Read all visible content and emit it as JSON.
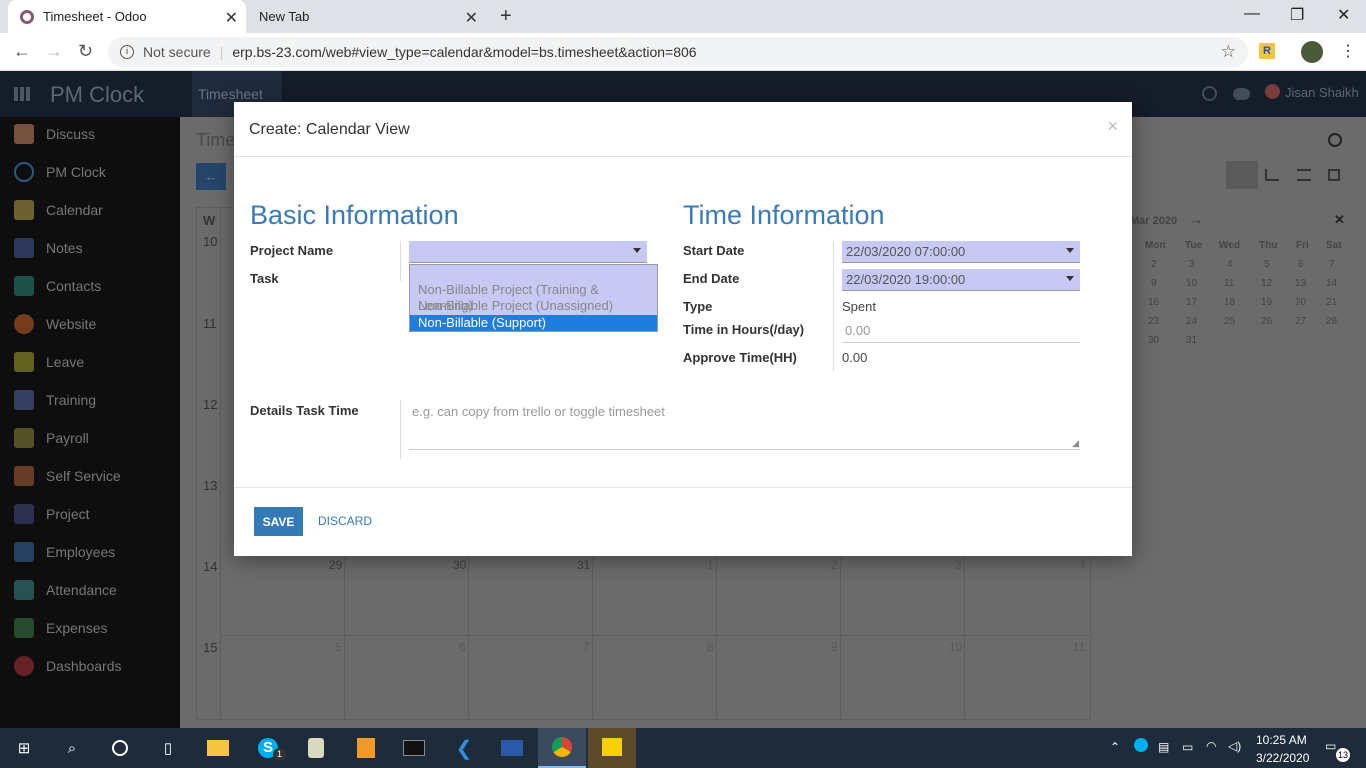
{
  "browser": {
    "tabs": [
      {
        "label": "Timesheet - Odoo",
        "active": true
      },
      {
        "label": "New Tab",
        "active": false
      }
    ],
    "security_label": "Not secure",
    "url": "erp.bs-23.com/web#view_type=calendar&model=bs.timesheet&action=806"
  },
  "app": {
    "name": "PM Clock",
    "top_menu": "Timesheet",
    "user": "Jisan Shaikh",
    "sidebar": [
      "Discuss",
      "PM Clock",
      "Calendar",
      "Notes",
      "Contacts",
      "Website",
      "Leave",
      "Training",
      "Payroll",
      "Self Service",
      "Project",
      "Employees",
      "Attendance",
      "Expenses",
      "Dashboards"
    ],
    "breadcrumb": "Time",
    "calendar": {
      "week_header": "W",
      "week_numbers": [
        "10",
        "11",
        "12",
        "13",
        "14",
        "15"
      ],
      "row14_days": [
        "29",
        "30",
        "31",
        "1",
        "2",
        "3",
        "4"
      ],
      "row15_days": [
        "5",
        "6",
        "7",
        "8",
        "9",
        "10",
        "11"
      ],
      "mini_month": "Mar 2020",
      "mini_weekdays": [
        "Mon",
        "Tue",
        "Wed",
        "Thu",
        "Fri",
        "Sat"
      ],
      "mini_rows": [
        [
          "2",
          "3",
          "4",
          "5",
          "6",
          "7"
        ],
        [
          "9",
          "10",
          "11",
          "12",
          "13",
          "14"
        ],
        [
          "16",
          "17",
          "18",
          "19",
          "20",
          "21"
        ],
        [
          "23",
          "24",
          "25",
          "26",
          "27",
          "28"
        ],
        [
          "30",
          "31",
          "",
          "",
          "",
          ""
        ]
      ]
    }
  },
  "modal": {
    "title": "Create: Calendar View",
    "close": "×",
    "basic_title": "Basic Information",
    "time_title": "Time Information",
    "project_label": "Project Name",
    "task_label": "Task",
    "project_options": [
      "Non-Billable Project (Training & Learning)",
      "Non-Billable Project (Unassigned)",
      "Non-Billable (Support)"
    ],
    "selected_option_index": 2,
    "start_label": "Start Date",
    "start_value": "22/03/2020 07:00:00",
    "end_label": "End Date",
    "end_value": "22/03/2020 19:00:00",
    "type_label": "Type",
    "type_value": "Spent",
    "hours_label": "Time in Hours(/day)",
    "hours_placeholder": "0.00",
    "approve_label": "Approve Time(HH)",
    "approve_value": "0.00",
    "details_label": "Details Task Time",
    "details_placeholder": "e.g. can copy from trello or toggle timesheet",
    "save": "SAVE",
    "discard": "DISCARD"
  },
  "taskbar": {
    "time": "10:25 AM",
    "date": "3/22/2020",
    "notifications": "13",
    "skype_badge": "1"
  },
  "colors": {
    "accent": "#337ab7",
    "section_title": "#3b7ab7",
    "select_bg": "#c8c8f4",
    "option_selected": "#1e7ee0"
  }
}
